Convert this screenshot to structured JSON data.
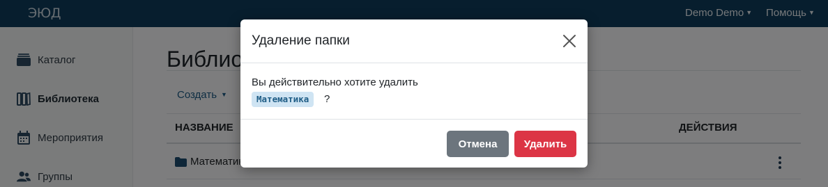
{
  "navbar": {
    "logo": "ЭЮД",
    "user_menu": "Demo Demo",
    "help_menu": "Помощь",
    "color": "#0f3c5c"
  },
  "sidebar": {
    "items": [
      {
        "label": "Каталог",
        "icon": "catalog-icon",
        "active": false
      },
      {
        "label": "Библиотека",
        "icon": "library-icon",
        "active": true
      },
      {
        "label": "Мероприятия",
        "icon": "calendar-icon",
        "active": false
      },
      {
        "label": "Группы",
        "icon": "users-icon",
        "active": false
      }
    ]
  },
  "main": {
    "page_title": "Библиотека",
    "create_button": "Создать",
    "table": {
      "columns": [
        "НАЗВАНИЕ",
        "ДЕЙСТВИЯ"
      ],
      "rows": [
        {
          "name": "Математика",
          "icon": "folder-icon"
        }
      ]
    }
  },
  "modal": {
    "title": "Удаление папки",
    "message": "Вы действительно хотите удалить",
    "folder_name": "Математика",
    "question_mark": "?",
    "cancel_label": "Отмена",
    "delete_label": "Удалить",
    "colors": {
      "cancel": "#6c757d",
      "delete": "#dc3545",
      "badge": "#cfe4f3"
    }
  }
}
